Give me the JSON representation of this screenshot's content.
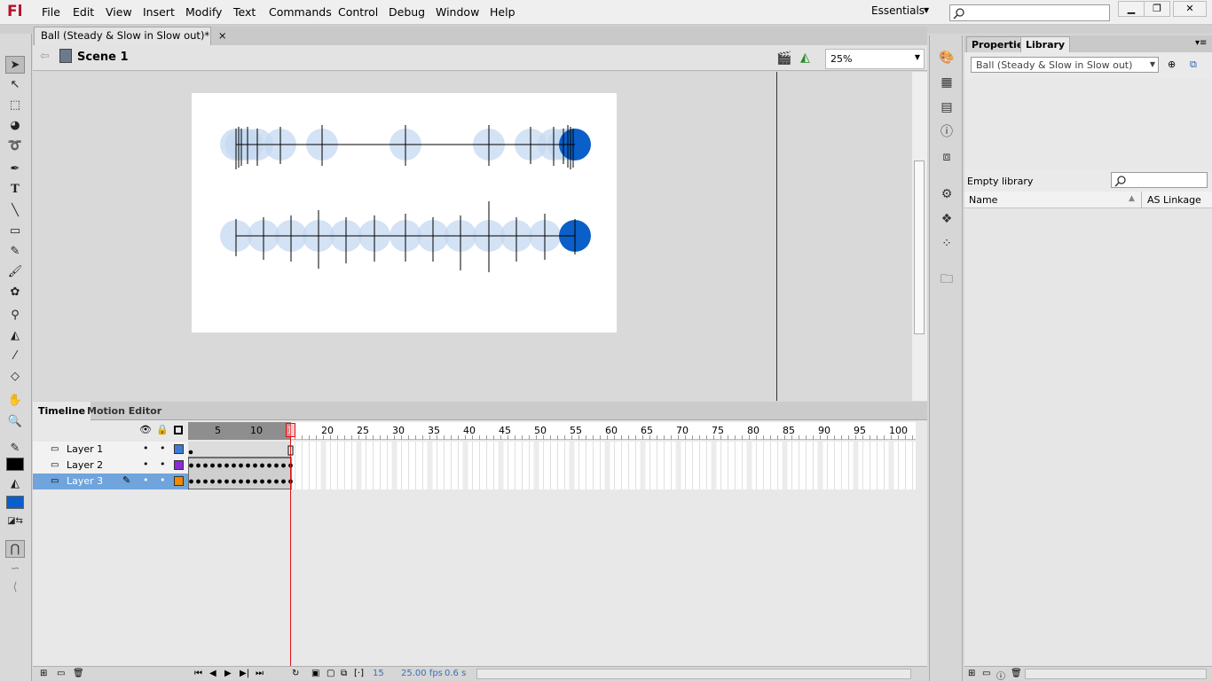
{
  "app": {
    "logo": "Fl"
  },
  "menu": [
    "File",
    "Edit",
    "View",
    "Insert",
    "Modify",
    "Text",
    "Commands",
    "Control",
    "Debug",
    "Window",
    "Help"
  ],
  "workspace": {
    "label": "Essentials"
  },
  "document": {
    "tab_title": "Ball (Steady & Slow in Slow out)*",
    "close": "×",
    "scene": "Scene 1",
    "zoom": "25%"
  },
  "timeline": {
    "tabs": [
      "Timeline",
      "Motion Editor"
    ],
    "ruler_labels": [
      "5",
      "10",
      "15",
      "20",
      "25",
      "30",
      "35",
      "40",
      "45",
      "50",
      "55",
      "60",
      "65",
      "70",
      "75",
      "80",
      "85",
      "90",
      "95",
      "100"
    ],
    "layers": [
      {
        "name": "Layer 1",
        "color": "#3c7bd9",
        "selected": false
      },
      {
        "name": "Layer 2",
        "color": "#8a2bd4",
        "selected": false
      },
      {
        "name": "Layer 3",
        "color": "#f08a00",
        "selected": true
      }
    ],
    "status": {
      "frame": "15",
      "fps": "25.00 fps",
      "time": "0.6 s"
    }
  },
  "panels": {
    "tabs": [
      "Properties",
      "Library"
    ],
    "library_select": "Ball (Steady & Slow in Slow out)",
    "empty_label": "Empty library",
    "columns": {
      "name": "Name",
      "linkage": "AS Linkage"
    }
  },
  "colors": {
    "ball": "#0a5fc8",
    "ball_ghost": "#c4d8f0",
    "accent": "#d11"
  }
}
